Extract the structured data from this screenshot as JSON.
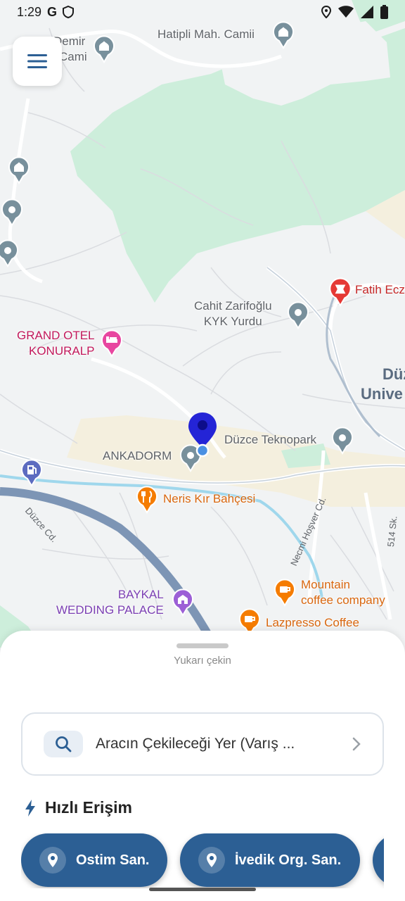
{
  "status_bar": {
    "time": "1:29",
    "left_icons": [
      "google-icon",
      "shield-icon"
    ],
    "right_icons": [
      "location-icon",
      "wifi-icon",
      "signal-icon",
      "battery-icon"
    ]
  },
  "map": {
    "places": {
      "hatipli": "Hatipli Mah. Camii",
      "demir_cami_1": "Demir",
      "demir_cami_2": "Cami",
      "cahit_1": "Cahit Zarifoğlu",
      "cahit_2": "KYK Yurdu",
      "grand_1": "GRAND OTEL",
      "grand_2": "KONURALP",
      "fatih": "Fatih Ecz",
      "uni_1": "Düz",
      "uni_2": "Unive",
      "ankadorm": "ANKADORM",
      "teknopark": "Düzce Teknopark",
      "neris": "Neris Kır Bahçesi",
      "baykal_1": "BAYKAL",
      "baykal_2": "WEDDING PALACE",
      "mountain_1": "Mountain",
      "mountain_2": "coffee company",
      "lazpresso": "Lazpresso Coffee"
    },
    "roads": {
      "duzce_cd": "Düzce Cd.",
      "necmi": "Necmi Hoşver Cd.",
      "sk514": "514 Sk."
    }
  },
  "sheet": {
    "pull_hint": "Yukarı çekin",
    "search_placeholder": "Aracın Çekileceği Yer (Varış ...",
    "quick_access_title": "Hızlı Erişim",
    "chips": [
      {
        "label": "Ostim San."
      },
      {
        "label": "İvedik Org. San."
      }
    ]
  },
  "colors": {
    "accent": "#2c5f94",
    "park": "#cdeedb",
    "map_bg": "#f1f3f4",
    "pin": "#2424d6"
  }
}
